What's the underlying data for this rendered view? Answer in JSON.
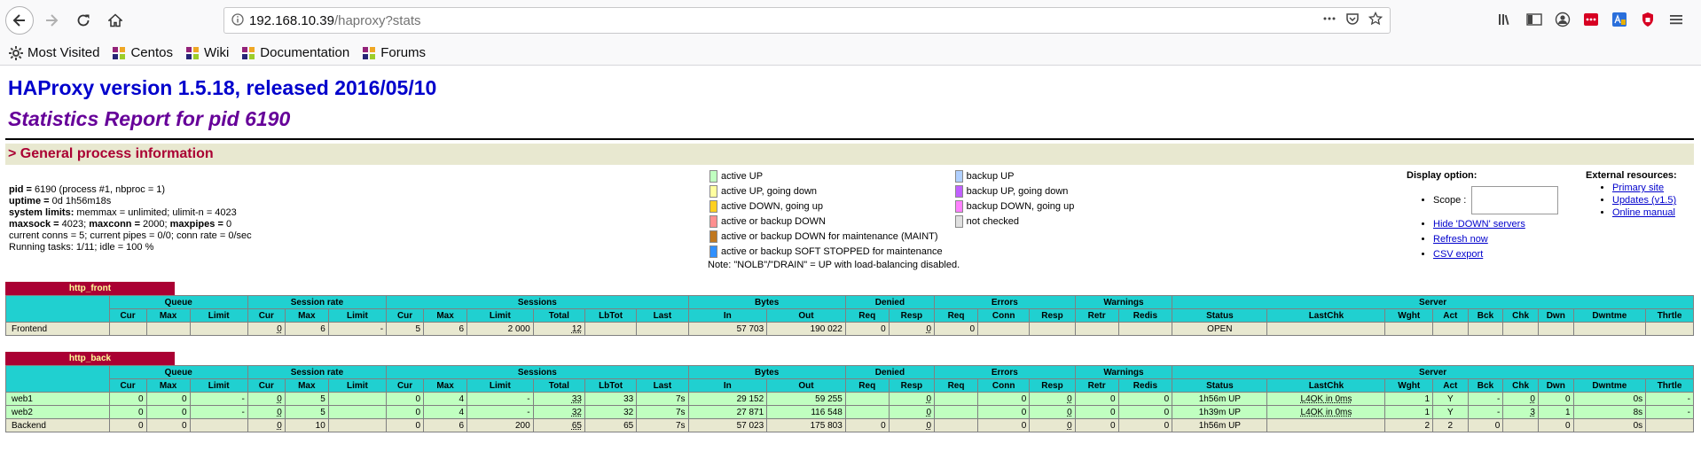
{
  "browser": {
    "url_host": "192.168.10.39",
    "url_path": "/haproxy?stats",
    "bookmarks": [
      "Most Visited",
      "Centos",
      "Wiki",
      "Documentation",
      "Forums"
    ],
    "colors": {
      "chrome": "#f9f9fa",
      "accent_red": "#d70022"
    }
  },
  "page": {
    "title": "HAProxy version 1.5.18, released 2016/05/10",
    "subtitle": "Statistics Report for pid 6190",
    "section_title": "> General process information"
  },
  "process": {
    "pid_label": "pid = ",
    "pid_value": "6190 (process #1, nbproc = 1)",
    "uptime_label": "uptime = ",
    "uptime_value": "0d 1h56m18s",
    "limits_label": "system limits:",
    "limits_value": " memmax = unlimited; ulimit-n = 4023",
    "maxsock_label": "maxsock = ",
    "maxsock_value": "4023; ",
    "maxconn_label": "maxconn = ",
    "maxconn_value": "2000; ",
    "maxpipes_label": "maxpipes = ",
    "maxpipes_value": "0",
    "conns_line": "current conns = 5; current pipes = 0/0; conn rate = 0/sec",
    "tasks_line": "Running tasks: 1/11; idle = 100 %"
  },
  "legend": {
    "left": [
      {
        "color": "#c0ffc0",
        "label": "active UP"
      },
      {
        "color": "#ffffa0",
        "label": "active UP, going down"
      },
      {
        "color": "#ffd020",
        "label": "active DOWN, going up"
      },
      {
        "color": "#ff9090",
        "label": "active or backup DOWN"
      },
      {
        "color": "#c07820",
        "label": "active or backup DOWN for maintenance (MAINT)"
      },
      {
        "color": "#3090ff",
        "label": "active or backup SOFT STOPPED for maintenance"
      }
    ],
    "right": [
      {
        "color": "#b0d0ff",
        "label": "backup UP"
      },
      {
        "color": "#c060ff",
        "label": "backup UP, going down"
      },
      {
        "color": "#ff80ff",
        "label": "backup DOWN, going up"
      },
      {
        "color": "#e0e0e0",
        "label": "not checked"
      }
    ],
    "note": "Note: \"NOLB\"/\"DRAIN\" = UP with load-balancing disabled."
  },
  "display_options": {
    "title": "Display option:",
    "scope_label": "Scope :",
    "links": [
      "Hide 'DOWN' servers",
      "Refresh now",
      "CSV export"
    ]
  },
  "external": {
    "title": "External resources:",
    "links": [
      "Primary site",
      "Updates (v1.5)",
      "Online manual"
    ]
  },
  "table_headers": {
    "groups": [
      "Queue",
      "Session rate",
      "Sessions",
      "Bytes",
      "Denied",
      "Errors",
      "Warnings",
      "Server"
    ],
    "cols": [
      "Cur",
      "Max",
      "Limit",
      "Cur",
      "Max",
      "Limit",
      "Cur",
      "Max",
      "Limit",
      "Total",
      "LbTot",
      "Last",
      "In",
      "Out",
      "Req",
      "Resp",
      "Req",
      "Conn",
      "Resp",
      "Retr",
      "Redis",
      "Status",
      "LastChk",
      "Wght",
      "Act",
      "Bck",
      "Chk",
      "Dwn",
      "Dwntme",
      "Thrtle"
    ]
  },
  "frontend": {
    "name": "http_front",
    "row": {
      "name": "Frontend",
      "cells": [
        "",
        "",
        "",
        "0",
        "6",
        "-",
        "5",
        "6",
        "2 000",
        "12",
        "",
        "",
        "57 703",
        "190 022",
        "0",
        "0",
        "0",
        "",
        "",
        "",
        "",
        "OPEN",
        "",
        "",
        "",
        "",
        "",
        "",
        "",
        ""
      ]
    }
  },
  "backend": {
    "name": "http_back",
    "rows": [
      {
        "name": "web1",
        "cells": [
          "0",
          "0",
          "-",
          "0",
          "5",
          "",
          "0",
          "4",
          "-",
          "33",
          "33",
          "7s",
          "29 152",
          "59 255",
          "",
          "0",
          "",
          "0",
          "0",
          "0",
          "0",
          "1h56m UP",
          "L4OK in 0ms",
          "1",
          "Y",
          "-",
          "0",
          "0",
          "0s",
          "-"
        ]
      },
      {
        "name": "web2",
        "cells": [
          "0",
          "0",
          "-",
          "0",
          "5",
          "",
          "0",
          "4",
          "-",
          "32",
          "32",
          "7s",
          "27 871",
          "116 548",
          "",
          "0",
          "",
          "0",
          "0",
          "0",
          "0",
          "1h39m UP",
          "L4OK in 0ms",
          "1",
          "Y",
          "-",
          "3",
          "1",
          "8s",
          "-"
        ]
      },
      {
        "name": "Backend",
        "cells": [
          "0",
          "0",
          "",
          "0",
          "10",
          "",
          "0",
          "6",
          "200",
          "65",
          "65",
          "7s",
          "57 023",
          "175 803",
          "0",
          "0",
          "",
          "0",
          "0",
          "0",
          "0",
          "1h56m UP",
          "",
          "2",
          "2",
          "0",
          "",
          "0",
          "0s",
          ""
        ]
      }
    ]
  }
}
